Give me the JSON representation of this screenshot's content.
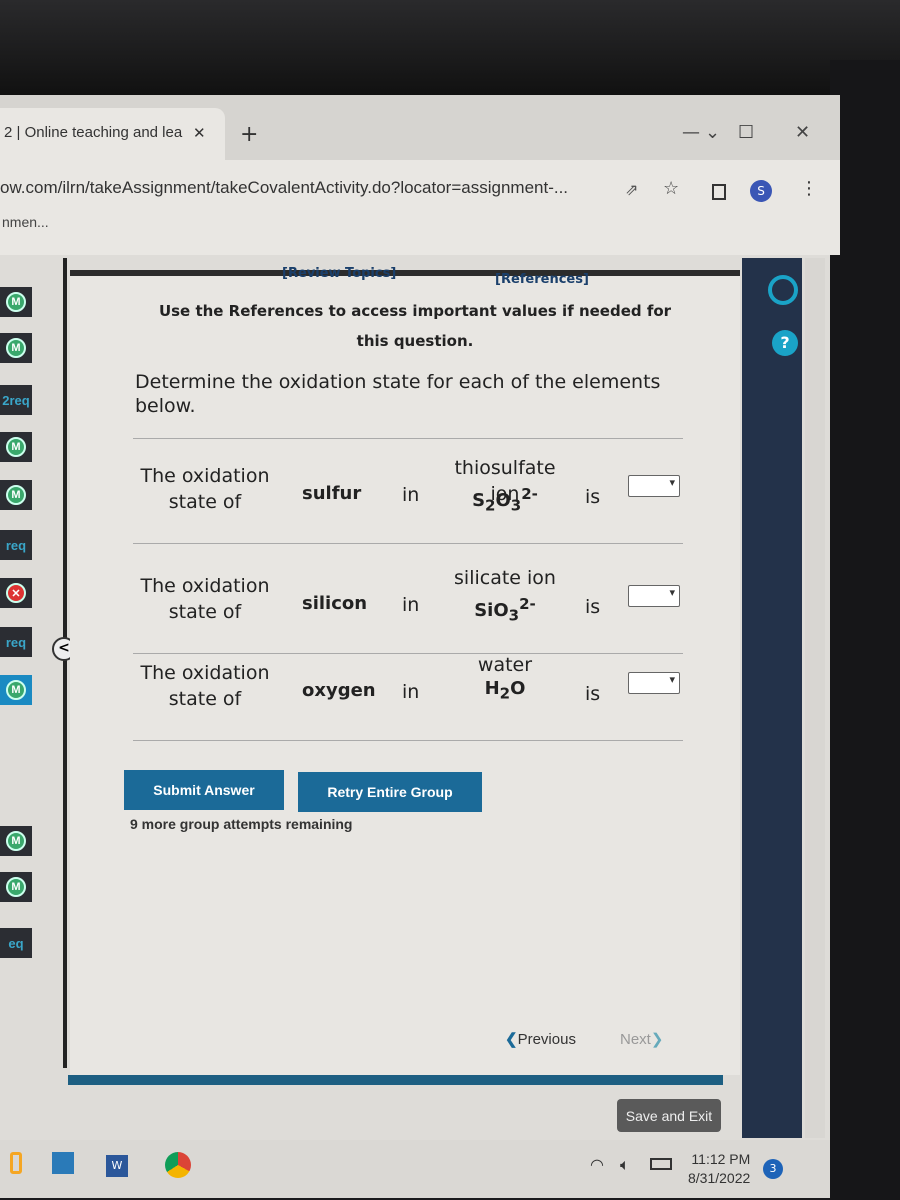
{
  "browser": {
    "tab_title": "2 | Online teaching and lea",
    "url": "ow.com/ilrn/takeAssignment/takeCovalentActivity.do?locator=assignment-...",
    "bookmark": "nmen...",
    "profile_initial": "S"
  },
  "sidebar": {
    "items": [
      {
        "type": "M"
      },
      {
        "type": "M"
      },
      {
        "type": "text",
        "label": "2req"
      },
      {
        "type": "M"
      },
      {
        "type": "M"
      },
      {
        "type": "text",
        "label": "req"
      },
      {
        "type": "X"
      },
      {
        "type": "text",
        "label": "req"
      },
      {
        "type": "M",
        "active": true
      },
      {
        "type": "M"
      },
      {
        "type": "M"
      },
      {
        "type": "text",
        "label": "eq"
      }
    ]
  },
  "question": {
    "review_topics": "[Review Topics]",
    "references": "[References]",
    "instruction": "Use the References to access important values if needed for this question.",
    "prompt": "Determine the oxidation state for each of the elements below.",
    "rows": [
      {
        "prefix": "The oxidation state of",
        "element": "sulfur",
        "in": "in",
        "compound_name": "thiosulfate ion",
        "formula": "S",
        "formula_html": "S<sub>2</sub>O<sub>3</sub><sup>2-</sup>",
        "is": "is",
        "value": ""
      },
      {
        "prefix": "The oxidation state of",
        "element": "silicon",
        "in": "in",
        "compound_name": "silicate ion",
        "formula_html": "SiO<sub>3</sub><sup>2-</sup>",
        "is": "is",
        "value": ""
      },
      {
        "prefix": "The oxidation state of",
        "element": "oxygen",
        "in": "in",
        "compound_name": "water",
        "formula_html": "H<sub>2</sub>O",
        "is": "is",
        "value": ""
      }
    ],
    "submit": "Submit Answer",
    "retry": "Retry Entire Group",
    "attempts": "9 more group attempts remaining",
    "previous": "Previous",
    "next": "Next",
    "save_exit": "Save and Exit"
  },
  "taskbar": {
    "time": "11:12 PM",
    "date": "8/31/2022",
    "notifications": "3"
  },
  "colors": {
    "accent": "#1b6a98",
    "sidebar_bg": "#2b2d33",
    "panel_bg": "#e8e6e2"
  }
}
